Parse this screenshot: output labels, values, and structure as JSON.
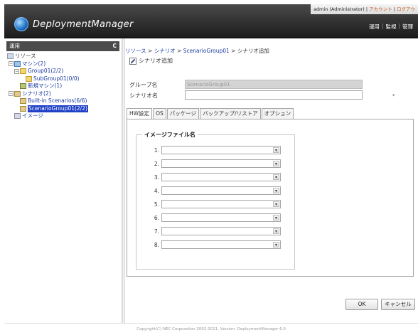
{
  "header": {
    "user": "admin (Administrator)",
    "links": [
      "アカウント",
      "ログアウ"
    ],
    "logo_text": "DeploymentManager",
    "menu": [
      "運用",
      "監視",
      "管理"
    ]
  },
  "sidebar": {
    "title": "運用",
    "refresh_glyph": "C",
    "tree": [
      {
        "label": "リソース"
      },
      {
        "label": "マシン(2)"
      },
      {
        "label": "Group01(2/2)"
      },
      {
        "label": "SubGroup01(0/0)"
      },
      {
        "label": "新規マシン(1)"
      },
      {
        "label": "シナリオ(2)"
      },
      {
        "label": "Built-in Scenarios(6/6)"
      },
      {
        "label": "ScenarioGroup01(2/2)"
      },
      {
        "label": "イメージ"
      }
    ]
  },
  "breadcrumb": {
    "items": [
      "リソース",
      "シナリオ",
      "ScenarioGroup01",
      "シナリオ追加"
    ],
    "separator": ">"
  },
  "page": {
    "title": "シナリオ追加",
    "group_label": "グループ名",
    "group_value": "ScenarioGroup01",
    "scenario_label": "シナリオ名",
    "scenario_value": "",
    "required_mark": "*"
  },
  "tabs": [
    "HW設定",
    "OS",
    "パッケージ",
    "バックアップ/リストア",
    "オプション"
  ],
  "image_section": {
    "legend": "イメージファイル名",
    "rows": [
      "1.",
      "2.",
      "3.",
      "4.",
      "5.",
      "6.",
      "7.",
      "8."
    ]
  },
  "buttons": {
    "ok": "OK",
    "cancel": "キャンセル"
  },
  "footer": "Copyright(C) NEC Corporation 2002-2011. Version: DeploymentManager 6.0"
}
